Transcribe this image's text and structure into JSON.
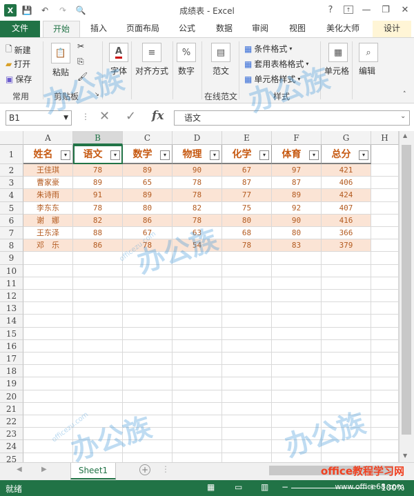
{
  "app": {
    "title": "成绩表 - Excel",
    "help": "?",
    "minimize": "—",
    "restore": "❐",
    "close": "✕"
  },
  "qat": {
    "save": "💾",
    "undo": "↶",
    "redo": "↷",
    "preview": "🔍"
  },
  "tabs": [
    "文件",
    "开始",
    "插入",
    "页面布局",
    "公式",
    "数据",
    "审阅",
    "视图",
    "美化大师",
    "设计"
  ],
  "ribbon": {
    "new": "新建",
    "open": "打开",
    "save": "保存",
    "group_common": "常用",
    "paste": "粘贴",
    "group_clipboard": "剪贴板",
    "font": "字体",
    "align": "对齐方式",
    "number": "数字",
    "template": "范文",
    "group_online": "在线范文",
    "cond_format": "条件格式",
    "table_format": "套用表格格式",
    "cell_style": "单元格样式",
    "group_style": "样式",
    "cells": "单元格",
    "edit": "编辑"
  },
  "formula_bar": {
    "name_box": "B1",
    "fx": "fx",
    "content": "语文"
  },
  "columns": [
    "A",
    "B",
    "C",
    "D",
    "E",
    "F",
    "G",
    "H"
  ],
  "rows": [
    "1",
    "2",
    "3",
    "4",
    "5",
    "6",
    "7",
    "8",
    "9",
    "10",
    "11",
    "12",
    "13",
    "14",
    "15",
    "16",
    "17",
    "18",
    "19",
    "20",
    "21",
    "22",
    "23",
    "24",
    "25"
  ],
  "table": {
    "headers": [
      "姓名",
      "语文",
      "数学",
      "物理",
      "化学",
      "体育",
      "总分"
    ],
    "rows": [
      [
        "王佳琪",
        "78",
        "89",
        "90",
        "67",
        "97",
        "421"
      ],
      [
        "曹家豪",
        "89",
        "65",
        "78",
        "87",
        "87",
        "406"
      ],
      [
        "朱诗雨",
        "91",
        "89",
        "78",
        "77",
        "89",
        "424"
      ],
      [
        "李东东",
        "78",
        "80",
        "82",
        "75",
        "92",
        "407"
      ],
      [
        "谢　娜",
        "82",
        "86",
        "78",
        "80",
        "90",
        "416"
      ],
      [
        "王东泽",
        "88",
        "67",
        "63",
        "68",
        "80",
        "366"
      ],
      [
        "邓　乐",
        "86",
        "78",
        "54",
        "78",
        "83",
        "379"
      ]
    ]
  },
  "sheet_tabs": [
    "Sheet1"
  ],
  "status": {
    "mode": "就绪",
    "zoom": "100%"
  },
  "watermark": {
    "brand": "办公族",
    "url": "officezu.com",
    "site": "office教程学习网",
    "site_url": "www.office68.com"
  },
  "colors": {
    "excel_green": "#217346",
    "header_text": "#c65911",
    "data_text": "#b35a1f",
    "stripe": "#fbe4d5"
  }
}
